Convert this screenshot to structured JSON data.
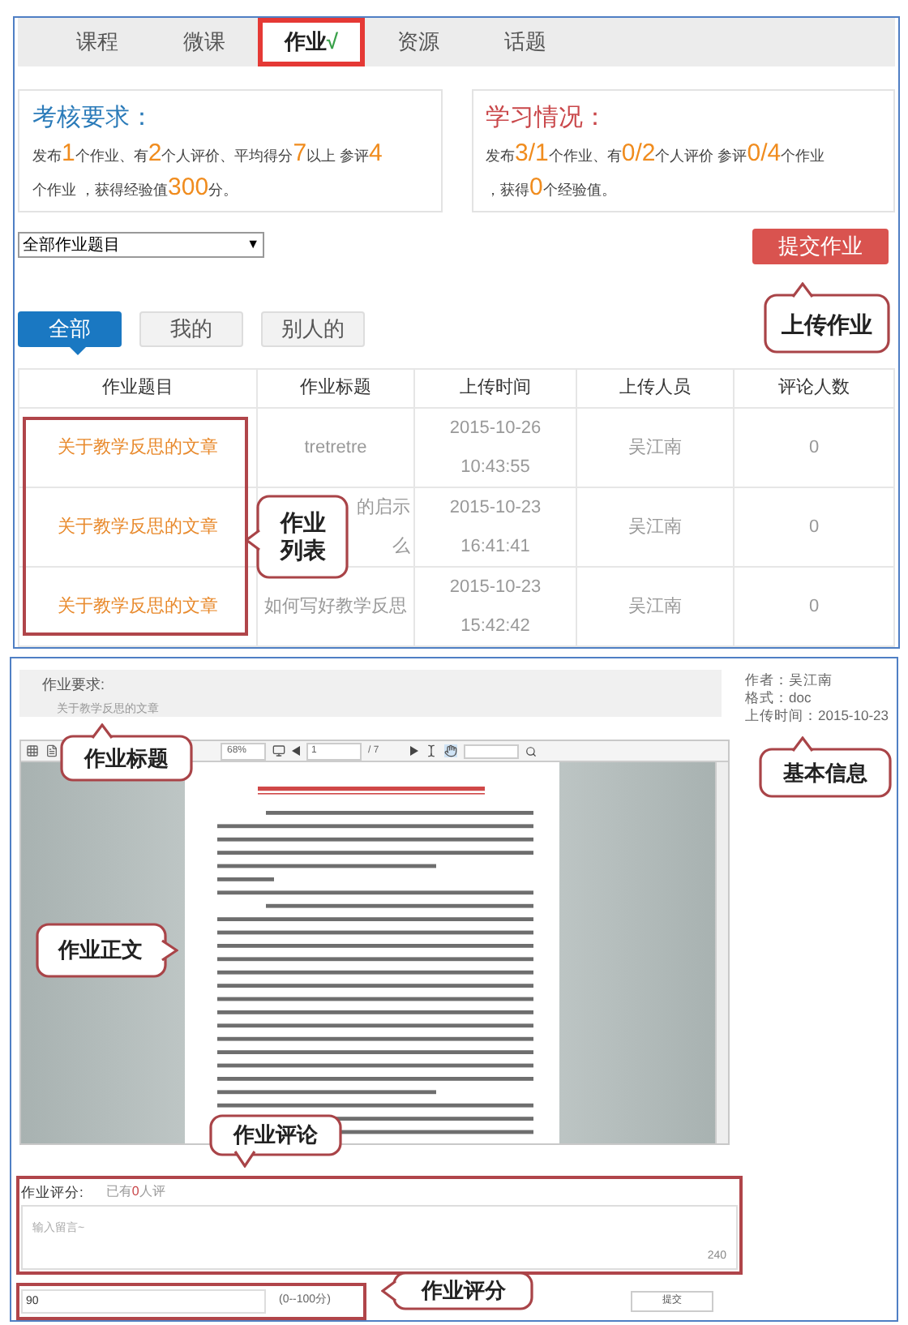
{
  "top_tabs": [
    {
      "label": "课程",
      "selected": false
    },
    {
      "label": "微课",
      "selected": false
    },
    {
      "label": "作业",
      "mark": "√",
      "selected": true
    },
    {
      "label": "资源",
      "selected": false
    },
    {
      "label": "话题",
      "selected": false
    }
  ],
  "cards": [
    {
      "title": "考核要求：",
      "color": "#2b7bb9",
      "lines": [
        [
          {
            "t": "发布",
            "hl": false
          },
          {
            "t": "1",
            "hl": true
          },
          {
            "t": "个作业、有",
            "hl": false
          },
          {
            "t": "2",
            "hl": true
          },
          {
            "t": "个人评价、平均得分",
            "hl": false
          },
          {
            "t": "7",
            "hl": true
          },
          {
            "t": "以上 参评",
            "hl": false
          },
          {
            "t": "4",
            "hl": true
          }
        ],
        [
          {
            "t": "个作业 ，获得经验值",
            "hl": false
          },
          {
            "t": "300",
            "hl": true
          },
          {
            "t": "分。",
            "hl": false
          }
        ]
      ]
    },
    {
      "title": "学习情况：",
      "color": "#c9474a",
      "lines": [
        [
          {
            "t": "发布",
            "hl": false
          },
          {
            "t": "3/1",
            "hl": true
          },
          {
            "t": "个作业、有",
            "hl": false
          },
          {
            "t": "0/2",
            "hl": true
          },
          {
            "t": "个人评价 参评",
            "hl": false
          },
          {
            "t": "0/4",
            "hl": true
          },
          {
            "t": "个作业",
            "hl": false
          }
        ],
        [
          {
            "t": "，获得",
            "hl": false
          },
          {
            "t": "0",
            "hl": true
          },
          {
            "t": "个经验值。",
            "hl": false
          }
        ]
      ]
    }
  ],
  "filter_select": {
    "value": "全部作业题目",
    "arrow": "▼"
  },
  "submit_button": "提交作业",
  "scope_tabs": [
    {
      "label": "全部",
      "selected": true
    },
    {
      "label": "我的",
      "selected": false
    },
    {
      "label": "别人的",
      "selected": false
    }
  ],
  "table": {
    "columns": [
      "作业题目",
      "作业标题",
      "上传时间",
      "上传人员",
      "评论人数"
    ],
    "rows": [
      {
        "topic": "关于教学反思的文章",
        "title": [
          "tretretre"
        ],
        "partial": false,
        "date": "2015-10-26",
        "time": "10:43:55",
        "uploader": "吴江南",
        "comments": "0"
      },
      {
        "topic": "关于教学反思的文章",
        "title": [
          "的启示",
          "么"
        ],
        "partial": true,
        "date": "2015-10-23",
        "time": "16:41:41",
        "uploader": "吴江南",
        "comments": "0"
      },
      {
        "topic": "关于教学反思的文章",
        "title": [
          "如何写好教学反思"
        ],
        "partial": false,
        "date": "2015-10-23",
        "time": "15:42:42",
        "uploader": "吴江南",
        "comments": "0"
      }
    ]
  },
  "top_callouts": [
    "上传作业",
    "作业列表"
  ],
  "requirement": {
    "label": "作业要求:",
    "value": "关于教学反思的文章"
  },
  "info": [
    "作者：吴江南",
    "格式：doc",
    "上传时间：2015-10-23"
  ],
  "viewer": {
    "zoom": "68%",
    "page": "1",
    "pages": "/ 7"
  },
  "rating": {
    "label": "作业评分:",
    "prefix": "已有",
    "count": "0",
    "suffix": "人评"
  },
  "comment": {
    "placeholder": "输入留言~",
    "remaining": "240"
  },
  "score": {
    "value": "90",
    "range": "(0--100分)"
  },
  "submit": "提交",
  "bottom_callouts": [
    "作业标题",
    "基本信息",
    "作业正文",
    "作业评论",
    "作业评分"
  ]
}
